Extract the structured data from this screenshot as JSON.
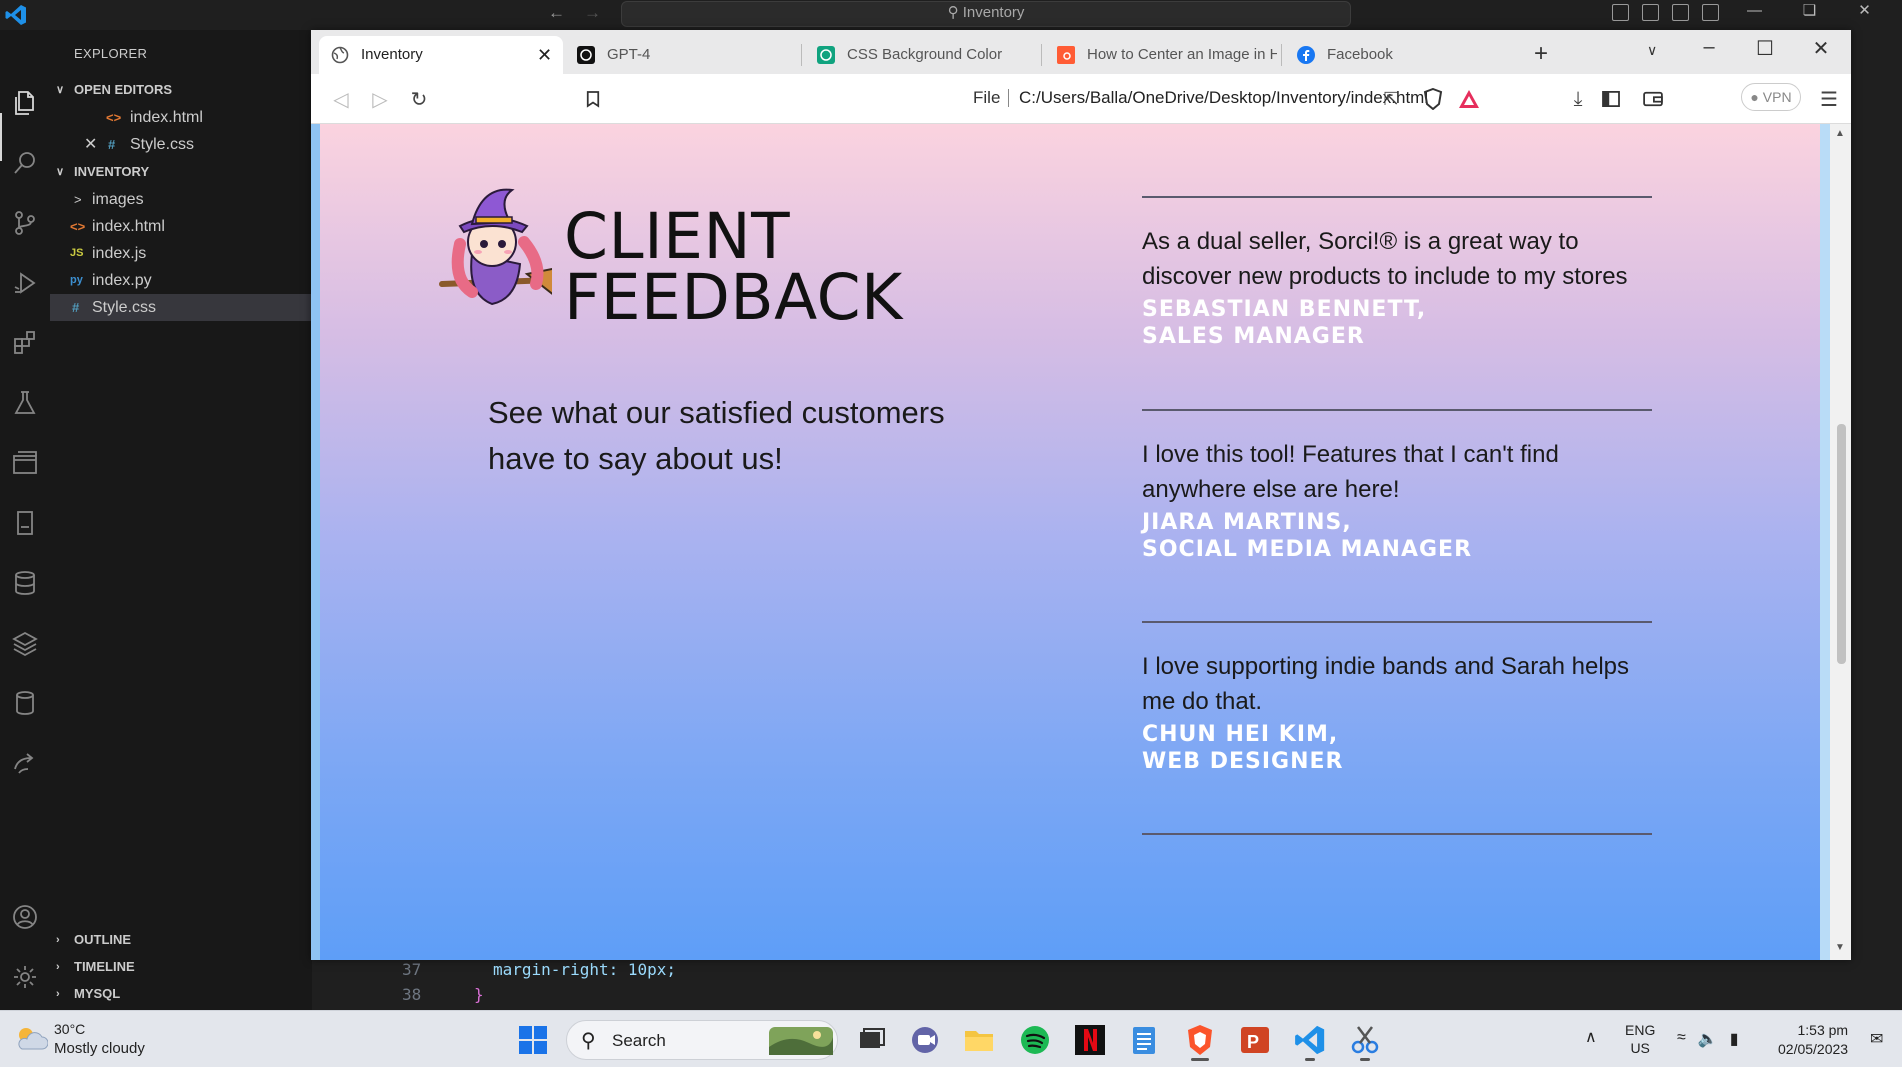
{
  "vscode": {
    "command_center": "Inventory",
    "explorer_title": "EXPLORER",
    "open_editors_label": "OPEN EDITORS",
    "open_editors": [
      {
        "name": "index.html",
        "icon": "<>"
      },
      {
        "name": "Style.css",
        "icon": "#"
      }
    ],
    "workspace_label": "INVENTORY",
    "files": [
      {
        "name": "images",
        "icon": ">"
      },
      {
        "name": "index.html",
        "icon": "<>"
      },
      {
        "name": "index.js",
        "icon": "JS"
      },
      {
        "name": "index.py",
        "icon": "py"
      },
      {
        "name": "Style.css",
        "icon": "#"
      }
    ],
    "bottom_sections": [
      "OUTLINE",
      "TIMELINE",
      "MYSQL"
    ],
    "code_lines": [
      {
        "num": "37",
        "text": "margin-right: 10px;"
      },
      {
        "num": "38",
        "text": "}"
      }
    ]
  },
  "browser": {
    "tabs": [
      {
        "label": "Inventory",
        "active": true
      },
      {
        "label": "GPT-4"
      },
      {
        "label": "CSS Background Color"
      },
      {
        "label": "How to Center an Image in H"
      },
      {
        "label": "Facebook"
      }
    ],
    "address_scheme": "File",
    "address_url": "C:/Users/Balla/OneDrive/Desktop/Inventory/index.html",
    "vpn_label": "VPN"
  },
  "page": {
    "title_line1": "CLIENT",
    "title_line2": "FEEDBACK",
    "subtitle": "See what our satisfied customers have to say about us!",
    "testimonials": [
      {
        "quote": "As a dual seller, Sorci!®  is a great way to discover new products to include to my stores",
        "name": "SEBASTIAN BENNETT,",
        "role": "SALES MANAGER"
      },
      {
        "quote": "I love this tool! Features that I can't find anywhere else are here!",
        "name": "JIARA MARTINS,",
        "role": "SOCIAL MEDIA MANAGER"
      },
      {
        "quote": "I love supporting indie bands and Sarah helps me do that.",
        "name": "CHUN HEI KIM,",
        "role": "WEB DESIGNER"
      }
    ]
  },
  "taskbar": {
    "weather_temp": "30°C",
    "weather_desc": "Mostly cloudy",
    "search_label": "Search",
    "lang_line1": "ENG",
    "lang_line2": "US",
    "time": "1:53 pm",
    "date": "02/05/2023"
  }
}
